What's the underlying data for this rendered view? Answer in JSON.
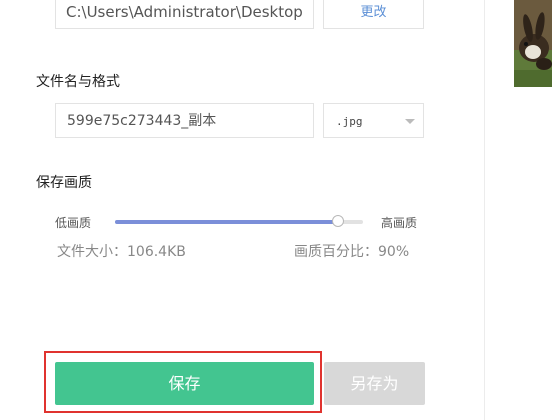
{
  "save_path": {
    "value": "C:\\Users\\Administrator\\Desktop",
    "change_label": "更改"
  },
  "filename_section": {
    "label": "文件名与格式",
    "filename": "599e75c273443_副本",
    "format": ".jpg"
  },
  "quality_section": {
    "label": "保存画质",
    "low_label": "低画质",
    "high_label": "高画质",
    "quality_level": 0.9,
    "file_size_text": "文件大小：106.4KB",
    "quality_percent_text": "画质百分比：90%"
  },
  "actions": {
    "save_label": "保存",
    "save_as_label": "另存为"
  },
  "colors": {
    "save_button": "#43c590",
    "slider_fill": "#7b8fd9",
    "highlight": "#e0332f",
    "link": "#5b8fd6"
  },
  "preview": {
    "icon": "rabbit-photo-thumbnail"
  }
}
